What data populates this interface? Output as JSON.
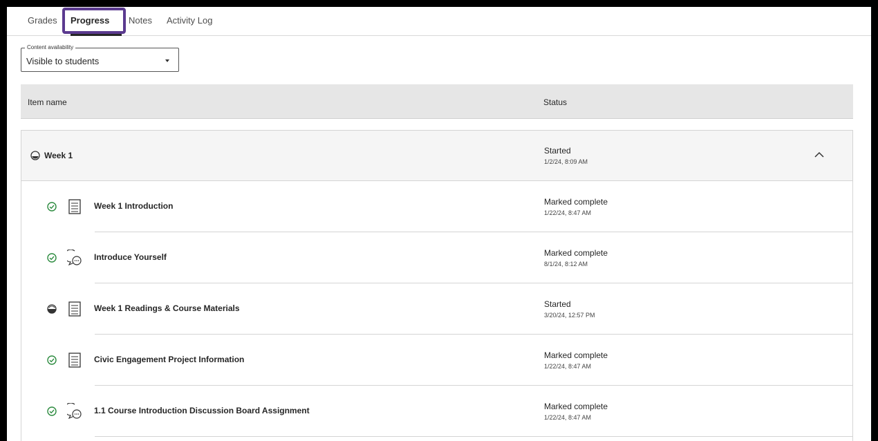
{
  "tabs": [
    {
      "label": "Grades"
    },
    {
      "label": "Progress"
    },
    {
      "label": "Notes"
    },
    {
      "label": "Activity Log"
    }
  ],
  "active_tab": "Progress",
  "filter": {
    "legend": "Content availability",
    "value": "Visible to students"
  },
  "table": {
    "col_item": "Item name",
    "col_status": "Status"
  },
  "group": {
    "title": "Week 1",
    "status": "Started",
    "date": "1/2/24, 8:09 AM",
    "icon": "half-circle-icon",
    "expanded": true
  },
  "items": [
    {
      "title": "Week 1 Introduction",
      "status": "Marked complete",
      "date": "1/22/24, 8:47 AM",
      "progress_icon": "check-circle-icon",
      "type_icon": "document-icon"
    },
    {
      "title": "Introduce Yourself",
      "status": "Marked complete",
      "date": "8/1/24, 8:12 AM",
      "progress_icon": "check-circle-icon",
      "type_icon": "discussion-icon"
    },
    {
      "title": "Week 1 Readings & Course Materials",
      "status": "Started",
      "date": "3/20/24, 12:57 PM",
      "progress_icon": "half-circle-icon",
      "type_icon": "document-icon"
    },
    {
      "title": "Civic Engagement Project Information",
      "status": "Marked complete",
      "date": "1/22/24, 8:47 AM",
      "progress_icon": "check-circle-icon",
      "type_icon": "document-icon"
    },
    {
      "title": "1.1 Course Introduction Discussion Board Assignment",
      "status": "Marked complete",
      "date": "1/22/24, 8:47 AM",
      "progress_icon": "check-circle-icon",
      "type_icon": "discussion-icon"
    }
  ],
  "colors": {
    "highlight": "#5b3a8f",
    "complete": "#2b8a3e",
    "header_bg": "#e6e6e6"
  }
}
